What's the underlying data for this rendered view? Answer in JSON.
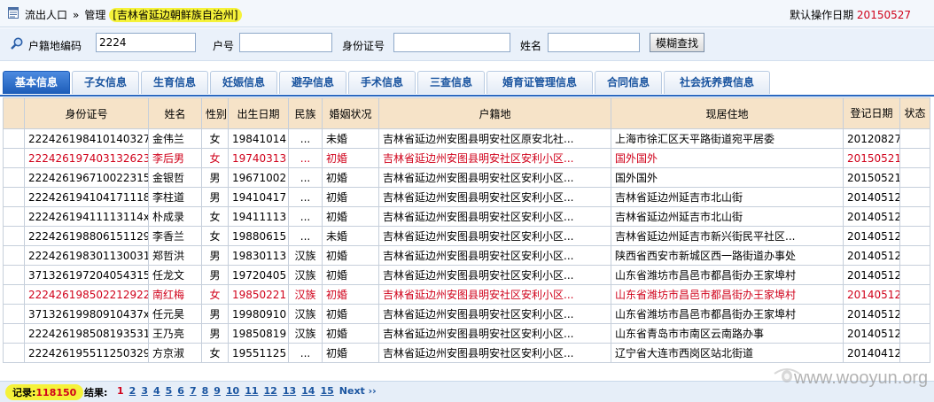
{
  "header": {
    "crumb1": "流出人口",
    "sep": "»",
    "crumb2": "管理",
    "area": "[吉林省延边朝鲜族自治州]",
    "date_label": "默认操作日期",
    "date_value": "20150527"
  },
  "search": {
    "f1_label": "户籍地编码",
    "f1_value": "2224",
    "f2_label": "户号",
    "f2_value": "",
    "f3_label": "身份证号",
    "f3_value": "",
    "f4_label": "姓名",
    "f4_value": "",
    "button": "模糊查找"
  },
  "tabs": [
    "基本信息",
    "子女信息",
    "生育信息",
    "妊娠信息",
    "避孕信息",
    "手术信息",
    "三查信息",
    "婚育证管理信息",
    "合同信息",
    "社会抚养费信息"
  ],
  "table": {
    "headers": [
      "",
      "身份证号",
      "姓名",
      "性别",
      "出生日期",
      "民族",
      "婚姻状况",
      "户籍地",
      "现居住地",
      "登记日期",
      "状态"
    ],
    "rows": [
      [
        "",
        "222426198410140327",
        "金伟兰",
        "女",
        "19841014",
        "...",
        "未婚",
        "吉林省延边州安图县明安社区原安北社...",
        "上海市徐汇区天平路街道宛平居委",
        "20120827",
        ""
      ],
      [
        "",
        "222426197403132623",
        "李后男",
        "女",
        "19740313",
        "...",
        "初婚",
        "吉林省延边州安图县明安社区安利小区...",
        "国外国外",
        "20150521",
        ""
      ],
      [
        "",
        "222426196710022315",
        "金银哲",
        "男",
        "19671002",
        "...",
        "初婚",
        "吉林省延边州安图县明安社区安利小区...",
        "国外国外",
        "20150521",
        ""
      ],
      [
        "",
        "222426194104171118",
        "李柱道",
        "男",
        "19410417",
        "...",
        "初婚",
        "吉林省延边州安图县明安社区安利小区...",
        "吉林省延边州延吉市北山街",
        "20140512",
        ""
      ],
      [
        "",
        "22242619411113114x",
        "朴成录",
        "女",
        "19411113",
        "...",
        "初婚",
        "吉林省延边州安图县明安社区安利小区...",
        "吉林省延边州延吉市北山街",
        "20140512",
        ""
      ],
      [
        "",
        "222426198806151129",
        "李香兰",
        "女",
        "19880615",
        "...",
        "未婚",
        "吉林省延边州安图县明安社区安利小区...",
        "吉林省延边州延吉市新兴街民平社区...",
        "20140512",
        ""
      ],
      [
        "",
        "222426198301130031",
        "郑哲洪",
        "男",
        "19830113",
        "汉族",
        "初婚",
        "吉林省延边州安图县明安社区安利小区...",
        "陕西省西安市新城区西一路街道办事处",
        "20140512",
        ""
      ],
      [
        "",
        "371326197204054315",
        "任龙文",
        "男",
        "19720405",
        "汉族",
        "初婚",
        "吉林省延边州安图县明安社区安利小区...",
        "山东省潍坊市昌邑市都昌街办王家埠村",
        "20140512",
        ""
      ],
      [
        "",
        "222426198502212922",
        "南红梅",
        "女",
        "19850221",
        "汉族",
        "初婚",
        "吉林省延边州安图县明安社区安利小区...",
        "山东省潍坊市昌邑市都昌街办王家埠村",
        "20140512",
        ""
      ],
      [
        "",
        "37132619980910437x",
        "任元昊",
        "男",
        "19980910",
        "汉族",
        "初婚",
        "吉林省延边州安图县明安社区安利小区...",
        "山东省潍坊市昌邑市都昌街办王家埠村",
        "20140512",
        ""
      ],
      [
        "",
        "222426198508193531",
        "王乃亮",
        "男",
        "19850819",
        "汉族",
        "初婚",
        "吉林省延边州安图县明安社区安利小区...",
        "山东省青岛市市南区云南路办事",
        "20140512",
        ""
      ],
      [
        "",
        "222426195511250329",
        "方京淑",
        "女",
        "19551125",
        "...",
        "初婚",
        "吉林省延边州安图县明安社区安利小区...",
        "辽宁省大连市西岗区站北街道",
        "20140412",
        ""
      ]
    ],
    "red_rows": [
      1,
      8
    ]
  },
  "footer": {
    "record_label": "记录:",
    "record_count": "118150",
    "result_label": "结果:",
    "pages": [
      "1",
      "2",
      "3",
      "4",
      "5",
      "6",
      "7",
      "8",
      "9",
      "10",
      "11",
      "12",
      "13",
      "14",
      "15"
    ],
    "next": "Next ››"
  },
  "watermark": {
    "text": "www.wooyun.org"
  },
  "colors": {
    "accent": "#1c5cb8",
    "header_bg": "#f6e3c8",
    "highlight": "#f5f23a",
    "red": "#d0021b"
  }
}
